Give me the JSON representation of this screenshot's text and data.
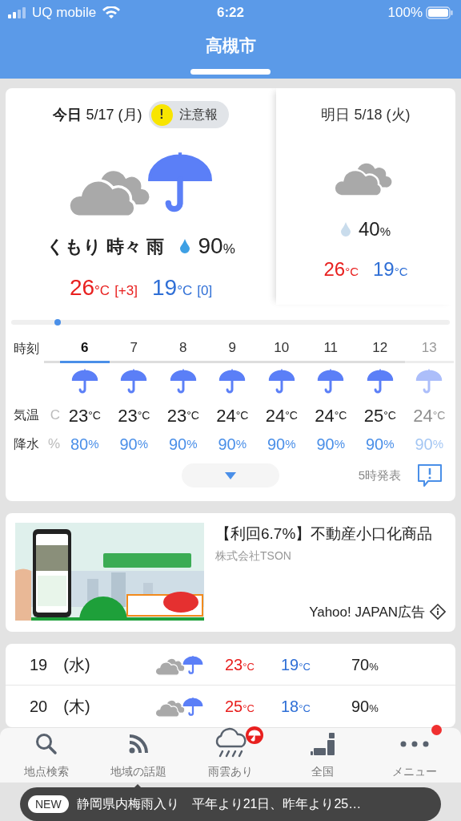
{
  "status_bar": {
    "carrier": "UQ mobile",
    "time": "6:22",
    "battery": "100%"
  },
  "header": {
    "title": "高槻市"
  },
  "today": {
    "label": "今日",
    "date": "5/17 (月)",
    "warning": {
      "mark": "!",
      "text": "注意報"
    },
    "condition": "くもり 時々 雨",
    "precip": {
      "value": "90",
      "unit": "%"
    },
    "high": {
      "value": "26",
      "unit": "°C",
      "diff": "[+3]"
    },
    "low": {
      "value": "19",
      "unit": "°C",
      "diff": "[0]"
    }
  },
  "tomorrow": {
    "label": "明日",
    "date": "5/18 (火)",
    "precip": {
      "value": "40",
      "unit": "%"
    },
    "high": {
      "value": "26",
      "unit": "°C"
    },
    "low": {
      "value": "19",
      "unit": "°C"
    }
  },
  "hourly": {
    "labels": {
      "time": "時刻",
      "temp": "気温",
      "precip": "降水"
    },
    "partial_column": {
      "temp": "C",
      "precip": "%"
    },
    "hours": [
      {
        "hour": "6",
        "selected": true,
        "faded": false,
        "temp": {
          "value": "23",
          "unit": "°C"
        },
        "precip": {
          "value": "80",
          "unit": "%"
        }
      },
      {
        "hour": "7",
        "selected": false,
        "faded": false,
        "temp": {
          "value": "23",
          "unit": "°C"
        },
        "precip": {
          "value": "90",
          "unit": "%"
        }
      },
      {
        "hour": "8",
        "selected": false,
        "faded": false,
        "temp": {
          "value": "23",
          "unit": "°C"
        },
        "precip": {
          "value": "90",
          "unit": "%"
        }
      },
      {
        "hour": "9",
        "selected": false,
        "faded": false,
        "temp": {
          "value": "24",
          "unit": "°C"
        },
        "precip": {
          "value": "90",
          "unit": "%"
        }
      },
      {
        "hour": "10",
        "selected": false,
        "faded": false,
        "temp": {
          "value": "24",
          "unit": "°C"
        },
        "precip": {
          "value": "90",
          "unit": "%"
        }
      },
      {
        "hour": "11",
        "selected": false,
        "faded": false,
        "temp": {
          "value": "24",
          "unit": "°C"
        },
        "precip": {
          "value": "90",
          "unit": "%"
        }
      },
      {
        "hour": "12",
        "selected": false,
        "faded": false,
        "temp": {
          "value": "25",
          "unit": "°C"
        },
        "precip": {
          "value": "90",
          "unit": "%"
        }
      },
      {
        "hour": "13",
        "selected": false,
        "faded": true,
        "temp": {
          "value": "24",
          "unit": "°C"
        },
        "precip": {
          "value": "90",
          "unit": "%"
        }
      }
    ],
    "issued": "5時発表"
  },
  "ad": {
    "title": "【利回6.7%】不動産小口化商品",
    "advertiser": "株式会社TSON",
    "sponsor": "Yahoo! JAPAN広告"
  },
  "daily": [
    {
      "day": "19",
      "weekday": "(水)",
      "high": {
        "value": "23",
        "unit": "°C"
      },
      "low": {
        "value": "19",
        "unit": "°C"
      },
      "precip": {
        "value": "70",
        "unit": "%"
      }
    },
    {
      "day": "20",
      "weekday": "(木)",
      "high": {
        "value": "25",
        "unit": "°C"
      },
      "low": {
        "value": "18",
        "unit": "°C"
      },
      "precip": {
        "value": "90",
        "unit": "%"
      }
    }
  ],
  "nav": [
    {
      "kind": "search",
      "label": "地点検索",
      "badge": false
    },
    {
      "kind": "feed",
      "label": "地域の話題",
      "badge": false
    },
    {
      "kind": "rain",
      "label": "雨雲あり",
      "badge": true
    },
    {
      "kind": "country",
      "label": "全国",
      "badge": false
    },
    {
      "kind": "menu",
      "label": "メニュー",
      "badge": true
    }
  ],
  "ticker": {
    "tag": "NEW",
    "text": "静岡県内梅雨入り　平年より21日、昨年より25…"
  }
}
